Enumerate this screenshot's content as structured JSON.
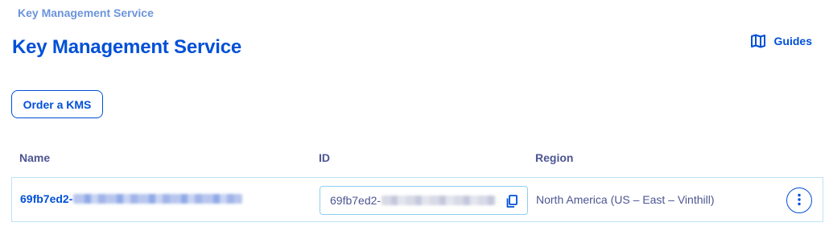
{
  "breadcrumb": {
    "label": "Key Management Service"
  },
  "header": {
    "title": "Key Management Service",
    "guides_label": "Guides",
    "guides_icon": "book-map-icon"
  },
  "toolbar": {
    "order_label": "Order a KMS"
  },
  "table": {
    "columns": [
      "Name",
      "ID",
      "Region"
    ],
    "rows": [
      {
        "name": "69fb7ed2-",
        "id": "69fb7ed2-",
        "region": "North America (US – East – Vinthill)"
      }
    ]
  },
  "icons": {
    "copy": "copy-icon",
    "more": "more-vertical-icon"
  },
  "colors": {
    "primary": "#0050d7",
    "breadcrumb": "#6b94dc",
    "text": "#4d5592",
    "row_border": "#bde3f6",
    "input_border": "#8fd0ee"
  }
}
